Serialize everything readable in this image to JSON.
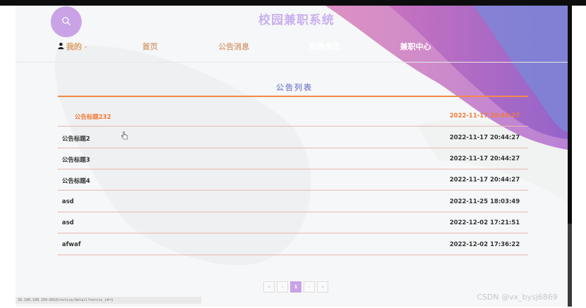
{
  "header": {
    "site_title": "校园兼职系统",
    "search_icon": "search-icon"
  },
  "nav": {
    "mine": "我的",
    "home": "首页",
    "notice": "公告消息",
    "info": "职场资讯",
    "job": "兼职中心"
  },
  "list": {
    "title": "公告列表",
    "rows": [
      {
        "title": "公告标题232",
        "date": "2022-11-17 20:44:27"
      },
      {
        "title": "公告标题2",
        "date": "2022-11-17 20:44:27"
      },
      {
        "title": "公告标题3",
        "date": "2022-11-17 20:44:27"
      },
      {
        "title": "公告标题4",
        "date": "2022-11-17 20:44:27"
      },
      {
        "title": "asd",
        "date": "2022-11-25 18:03:49"
      },
      {
        "title": "asd",
        "date": "2022-12-02 17:21:51"
      },
      {
        "title": "afwaf",
        "date": "2022-12-02 17:36:22"
      }
    ]
  },
  "pager": {
    "first": "«",
    "prev": "‹",
    "current": "1",
    "next": "›",
    "last": "»"
  },
  "status_url": "39.108.108.209:8018/notice/detail?notice_id=1",
  "watermark": "CSDN @vx_bysj6869",
  "colors": {
    "accent_purple": "#c9a3e6",
    "accent_orange": "#f08a4a",
    "title_blue": "#8a8fd0"
  }
}
